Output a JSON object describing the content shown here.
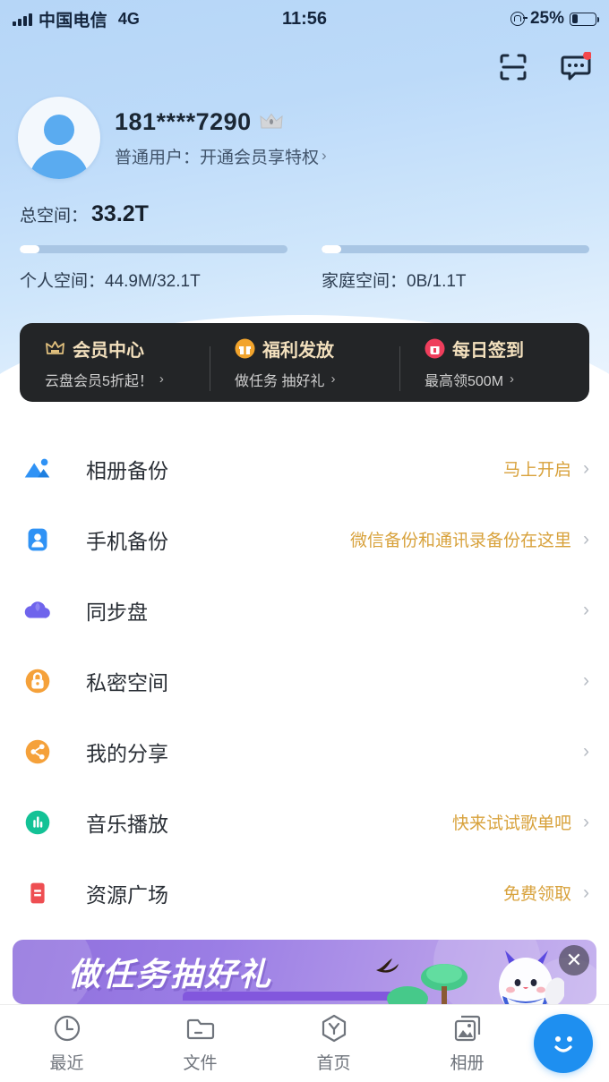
{
  "status_bar": {
    "carrier": "中国电信",
    "network": "4G",
    "time": "11:56",
    "battery_percent": "25%",
    "battery_level": 25,
    "signal_icon": "signal-bars-icon",
    "lock_icon": "rotation-lock-icon",
    "battery_icon": "battery-icon"
  },
  "top_actions": [
    {
      "name": "scan-icon",
      "label": "扫一扫"
    },
    {
      "name": "message-icon",
      "label": "消息",
      "badge": true
    }
  ],
  "profile": {
    "avatar_icon": "default-avatar-icon",
    "phone": "181****7290",
    "crown_icon": "crown-icon",
    "member_text": "普通用户：开通会员享特权",
    "chevron": "›"
  },
  "storage": {
    "total_label": "总空间：",
    "total_value": "33.2T",
    "bars": [
      {
        "label": "个人空间：44.9M/32.1T",
        "percent": 3
      },
      {
        "label": "家庭空间：0B/1.1T",
        "percent": 3
      }
    ]
  },
  "promo_card": {
    "columns": [
      {
        "icon": "vip-crown-icon",
        "title": "会员中心",
        "subtitle": "云盘会员5折起！",
        "chevron": "›"
      },
      {
        "icon": "gift-icon",
        "title": "福利发放",
        "subtitle": "做任务 抽好礼",
        "chevron": "›"
      },
      {
        "icon": "calendar-checkin-icon",
        "title": "每日签到",
        "subtitle": "最高领500M",
        "chevron": "›"
      }
    ]
  },
  "menu": {
    "items": [
      {
        "icon": "photo-backup-icon",
        "label": "相册备份",
        "hint": "马上开启",
        "chevron": "›"
      },
      {
        "icon": "phone-backup-icon",
        "label": "手机备份",
        "hint": "微信备份和通讯录备份在这里",
        "chevron": "›"
      },
      {
        "icon": "sync-cloud-icon",
        "label": "同步盘",
        "hint": "",
        "chevron": "›"
      },
      {
        "icon": "private-lock-icon",
        "label": "私密空间",
        "hint": "",
        "chevron": "›"
      },
      {
        "icon": "share-icon",
        "label": "我的分享",
        "hint": "",
        "chevron": "›"
      },
      {
        "icon": "music-icon",
        "label": "音乐播放",
        "hint": "快来试试歌单吧",
        "chevron": "›"
      },
      {
        "icon": "resource-doc-icon",
        "label": "资源广场",
        "hint": "免费领取",
        "chevron": "›"
      }
    ]
  },
  "banner": {
    "title": "做任务抽好礼",
    "close_icon": "close-icon",
    "close_label": "✕"
  },
  "tabbar": {
    "tabs": [
      {
        "icon": "clock-icon",
        "label": "最近"
      },
      {
        "icon": "folder-icon",
        "label": "文件"
      },
      {
        "icon": "home-hexagon-icon",
        "label": "首页"
      },
      {
        "icon": "album-icon",
        "label": "相册"
      }
    ],
    "fab": {
      "icon": "smiley-face-icon",
      "label": "助手"
    }
  },
  "colors": {
    "accent_blue": "#1e8ff0",
    "hint_gold": "#d8a23c",
    "promo_bg": "#232527",
    "promo_title": "#f3e0bd",
    "banner_purple": "#9b7ee5"
  }
}
